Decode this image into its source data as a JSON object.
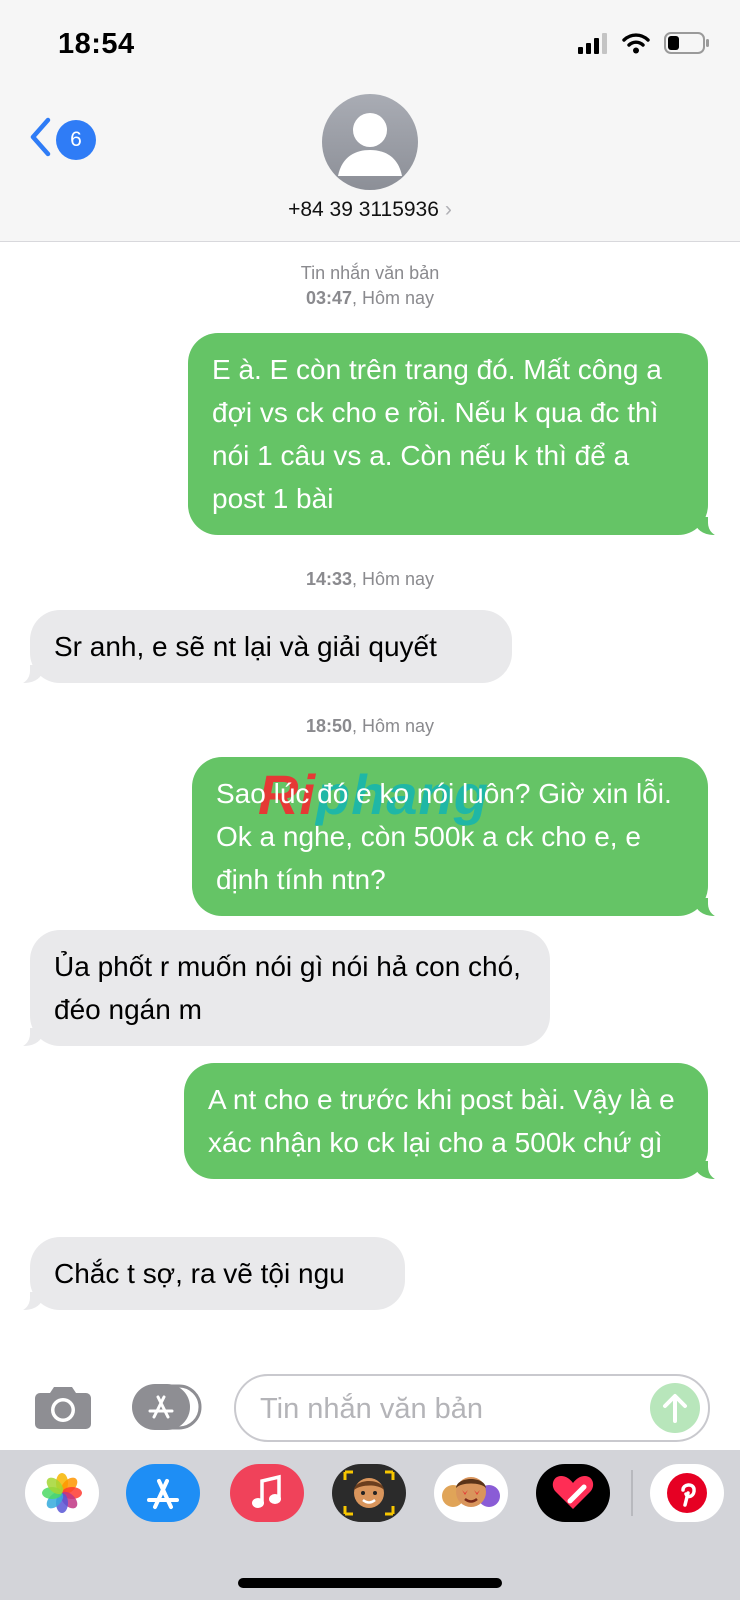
{
  "status_bar": {
    "time": "18:54"
  },
  "header": {
    "back_count": "6",
    "contact": "+84 39 3115936",
    "chevron": "›"
  },
  "thread": {
    "service_label": "Tin nhắn văn bản",
    "timestamps": [
      "03:47",
      "14:33",
      "18:50"
    ],
    "day_label": "Hôm nay",
    "messages": [
      {
        "from": "me",
        "text": "E à. E còn trên trang đó. Mất công a đợi vs ck cho e rồi. Nếu k qua đc thì nói 1 câu vs a. Còn nếu k thì để a post 1 bài"
      },
      {
        "from": "them",
        "text": "Sr anh, e sẽ nt lại và giải quyết"
      },
      {
        "from": "me",
        "text": "Sao lúc đó e ko nói luôn? Giờ xin lỗi. Ok a nghe, còn 500k a ck cho e, e định tính ntn?"
      },
      {
        "from": "them",
        "text": "Ủa phốt r muốn nói gì nói hả con chó, đéo ngán m"
      },
      {
        "from": "me",
        "text": "A nt cho e trước khi post bài. Vậy là e xác nhận ko ck lại cho a 500k chứ gì"
      },
      {
        "from": "them",
        "text": "Chắc t sợ, ra vẽ tội ngu"
      }
    ]
  },
  "watermark": {
    "part1": "Ri",
    "part2": "phang"
  },
  "composer": {
    "placeholder": "Tin nhắn văn bản"
  },
  "drawer": {
    "apps": [
      "photos-icon",
      "app-store-icon",
      "music-icon",
      "memoji-icon",
      "animoji-icon",
      "digital-touch-icon",
      "pinterest-icon"
    ]
  },
  "colors": {
    "sent_bubble": "#65c466",
    "received_bubble": "#e9e9eb",
    "accent": "#2f7cf6"
  }
}
